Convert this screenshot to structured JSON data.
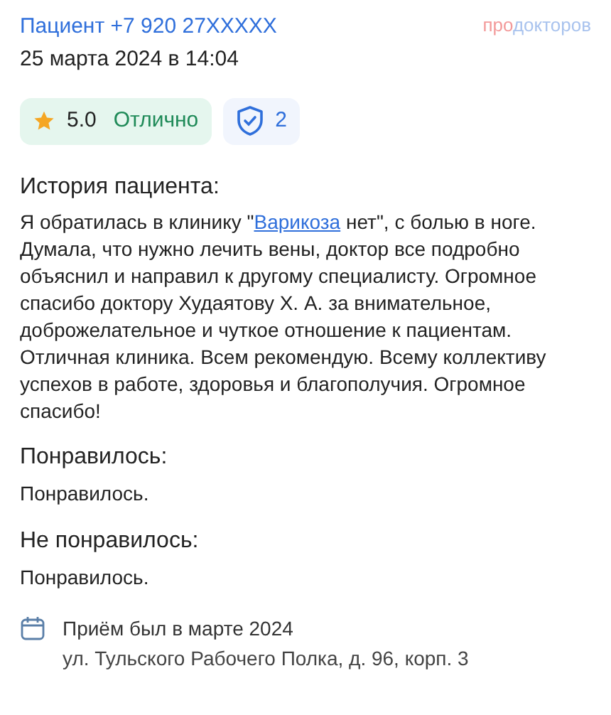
{
  "author": "Пациент +7 920 27XXXXX",
  "logo": {
    "part_1": "про",
    "part_2": "докторов"
  },
  "date": "25 марта 2024 в 14:04",
  "rating": {
    "value": "5.0",
    "label": "Отлично"
  },
  "verified": {
    "count": "2"
  },
  "sections": [
    {
      "title": "История пациента:",
      "text_before": "Я обратилась в клинику \"",
      "link": "Варикоза",
      "text_after": " нет\", с болью в ноге. Думала, что нужно лечить вены, доктор все подробно объяснил и направил к другому специалисту. Огромное спасибо доктору Худаятову Х. А. за внимательное, доброжелательное и чуткое отношение к пациентам. Отличная клиника. Всем рекомендую. Всему коллективу успехов в работе, здоровья и благополучия. Огромное спасибо!"
    },
    {
      "title": "Понравилось:",
      "text_before": "Понравилось."
    },
    {
      "title": "Не понравилось:",
      "text_before": "Понравилось."
    }
  ],
  "visit": {
    "date": "Приём был в марте 2024",
    "address": "ул. Тульского Рабочего Полка, д. 96, корп. 3"
  }
}
